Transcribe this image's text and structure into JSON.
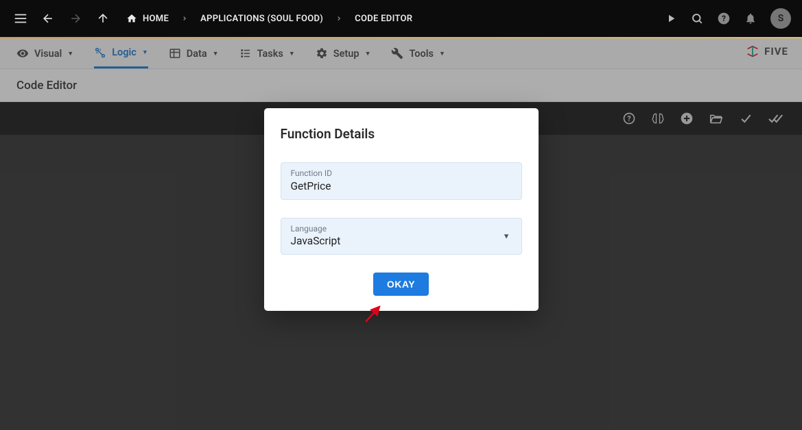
{
  "breadcrumb": {
    "home": "HOME",
    "app": "APPLICATIONS (SOUL FOOD)",
    "page": "CODE EDITOR"
  },
  "avatar_initial": "S",
  "tabs": {
    "visual": "Visual",
    "logic": "Logic",
    "data": "Data",
    "tasks": "Tasks",
    "setup": "Setup",
    "tools": "Tools"
  },
  "logo_text": "FIVE",
  "page_title": "Code Editor",
  "dialog": {
    "title": "Function Details",
    "function_id_label": "Function ID",
    "function_id_value": "GetPrice",
    "language_label": "Language",
    "language_value": "JavaScript",
    "okay": "OKAY"
  }
}
